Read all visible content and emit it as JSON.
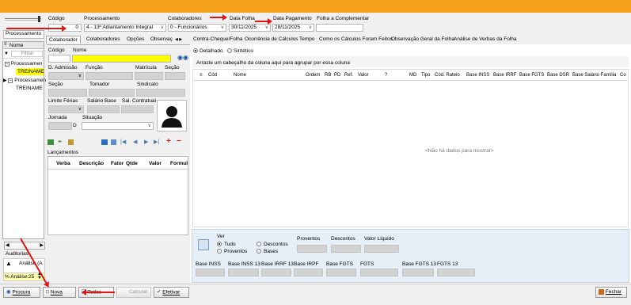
{
  "header": {
    "codigo_label": "Código",
    "codigo_value": "0",
    "processamento_label": "Processamento",
    "processamento_value": "4 - 13º Adiantamento Integral",
    "colaboradores_label": "Colaboradores",
    "colaboradores_value": "0 - Funcionários",
    "data_folha_label": "Data Folha",
    "data_folha_value": "30/11/2025",
    "data_pagamento_label": "Data Pagamento",
    "data_pagamento_value": "28/11/2025",
    "folha_complementar_label": "Folha a Complementar"
  },
  "left_panel": {
    "processamento_tab": "Processamento",
    "nome_header": "Nome",
    "filter_placeholder": "Filtrar",
    "group1_label": "Processamen",
    "group1_item": "TREINAME",
    "group2_label": "Processamen",
    "group2_item": "TREINAME",
    "auditorias_label": "Auditorias",
    "analise_label": "Análise (A",
    "analise_pct_label": "% Análise:",
    "analise_pct_value": "25"
  },
  "mid_panel": {
    "tabs": [
      "Colaborador",
      "Colaboradores",
      "Opções",
      "Observaç"
    ],
    "codigo": "Código",
    "nome": "Nome",
    "data_admissao": "D. Admissão",
    "funcao": "Função",
    "matricula": "Matrícula",
    "secao": "Seção",
    "secao2": "Seção",
    "tomador": "Tomador",
    "sindicato": "Sindicato",
    "limite_ferias": "Limite Férias",
    "salario_base": "Salário Base",
    "sal_contratual": "Sal. Contratual",
    "jornada": "Jornada",
    "jornada_d": "D",
    "situacao": "Situação",
    "lancamentos": "Lançamentos",
    "lanc_columns": [
      "Verba",
      "Descrição",
      "Fator",
      "Qtde",
      "Valor",
      "Formul"
    ]
  },
  "right_panel": {
    "tabs": [
      "Contra-Cheque/Folha",
      "Ocorrência de Cálculos",
      "Tempo",
      "Como os Cálculos Foram Feitos",
      "Observação Geral da Folha",
      "Análise de Verbas da Folha"
    ],
    "radio_detalhado": "Detalhado",
    "radio_sintetico": "Sintético",
    "group_hint": "Arraste um cabeçalho da coluna aqui para agrupar por essa coluna",
    "columns": [
      "Cód",
      "Nome",
      "Ordem",
      "RB",
      "PD",
      "Ref.",
      "Valor",
      "?",
      "MD",
      "Tipo",
      "Cód. Rateio",
      "Base INSS",
      "Base IRRF",
      "Base FGTS",
      "Base DSR",
      "Base Salário Família",
      "Co"
    ],
    "empty_text": "<Não há dados para mostrar>",
    "ver_label": "Ver",
    "ver_tudo": "Tudo",
    "ver_descontos": "Descontos",
    "ver_proventos": "Proventos",
    "ver_bases": "Bases",
    "proventos_label": "Proventos",
    "descontos_label": "Descontos",
    "valor_liquido_label": "Valor Líquido",
    "base_labels": [
      "Base INSS",
      "Base INSS 13",
      "Base IRRF 13",
      "Base IRPF",
      "Base FGTS",
      "FGTS",
      "Base FGTS 13",
      "FGTS 13"
    ]
  },
  "footer": {
    "procura": "Procura",
    "nova": "Nova",
    "todos": "Todos",
    "calcular": "Calcular",
    "efetivar": "Efetivar",
    "fechar": "Fechar"
  },
  "colors": {
    "top_bar": "#f5a21a",
    "highlight": "#ffff00",
    "annotation_arrow": "#e01414"
  }
}
